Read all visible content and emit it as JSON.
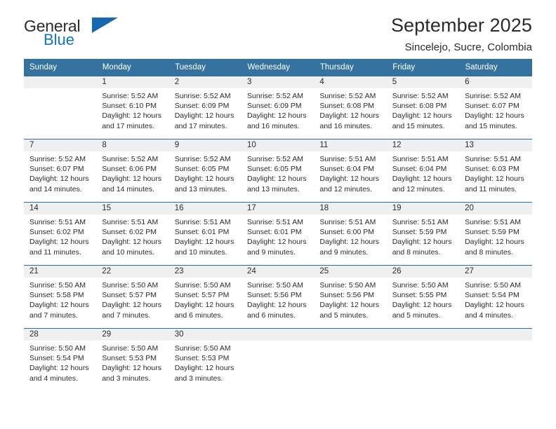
{
  "brand": {
    "name_part1": "General",
    "name_part2": "Blue",
    "triangle_color": "#1668b0",
    "blue_text_color": "#1277bc"
  },
  "header": {
    "title": "September 2025",
    "subtitle": "Sincelejo, Sucre, Colombia"
  },
  "theme": {
    "header_row_bg": "#34739f",
    "day_band_bg": "#f0f0f0",
    "row_border": "#2d6ca2"
  },
  "calendar": {
    "weekday_headers": [
      "Sunday",
      "Monday",
      "Tuesday",
      "Wednesday",
      "Thursday",
      "Friday",
      "Saturday"
    ],
    "weeks": [
      [
        {
          "day": "",
          "sunrise": "",
          "sunset": "",
          "daylight_line1": "",
          "daylight_line2": "",
          "empty": true
        },
        {
          "day": "1",
          "sunrise": "Sunrise: 5:52 AM",
          "sunset": "Sunset: 6:10 PM",
          "daylight_line1": "Daylight: 12 hours",
          "daylight_line2": "and 17 minutes."
        },
        {
          "day": "2",
          "sunrise": "Sunrise: 5:52 AM",
          "sunset": "Sunset: 6:09 PM",
          "daylight_line1": "Daylight: 12 hours",
          "daylight_line2": "and 17 minutes."
        },
        {
          "day": "3",
          "sunrise": "Sunrise: 5:52 AM",
          "sunset": "Sunset: 6:09 PM",
          "daylight_line1": "Daylight: 12 hours",
          "daylight_line2": "and 16 minutes."
        },
        {
          "day": "4",
          "sunrise": "Sunrise: 5:52 AM",
          "sunset": "Sunset: 6:08 PM",
          "daylight_line1": "Daylight: 12 hours",
          "daylight_line2": "and 16 minutes."
        },
        {
          "day": "5",
          "sunrise": "Sunrise: 5:52 AM",
          "sunset": "Sunset: 6:08 PM",
          "daylight_line1": "Daylight: 12 hours",
          "daylight_line2": "and 15 minutes."
        },
        {
          "day": "6",
          "sunrise": "Sunrise: 5:52 AM",
          "sunset": "Sunset: 6:07 PM",
          "daylight_line1": "Daylight: 12 hours",
          "daylight_line2": "and 15 minutes."
        }
      ],
      [
        {
          "day": "7",
          "sunrise": "Sunrise: 5:52 AM",
          "sunset": "Sunset: 6:07 PM",
          "daylight_line1": "Daylight: 12 hours",
          "daylight_line2": "and 14 minutes."
        },
        {
          "day": "8",
          "sunrise": "Sunrise: 5:52 AM",
          "sunset": "Sunset: 6:06 PM",
          "daylight_line1": "Daylight: 12 hours",
          "daylight_line2": "and 14 minutes."
        },
        {
          "day": "9",
          "sunrise": "Sunrise: 5:52 AM",
          "sunset": "Sunset: 6:05 PM",
          "daylight_line1": "Daylight: 12 hours",
          "daylight_line2": "and 13 minutes."
        },
        {
          "day": "10",
          "sunrise": "Sunrise: 5:52 AM",
          "sunset": "Sunset: 6:05 PM",
          "daylight_line1": "Daylight: 12 hours",
          "daylight_line2": "and 13 minutes."
        },
        {
          "day": "11",
          "sunrise": "Sunrise: 5:51 AM",
          "sunset": "Sunset: 6:04 PM",
          "daylight_line1": "Daylight: 12 hours",
          "daylight_line2": "and 12 minutes."
        },
        {
          "day": "12",
          "sunrise": "Sunrise: 5:51 AM",
          "sunset": "Sunset: 6:04 PM",
          "daylight_line1": "Daylight: 12 hours",
          "daylight_line2": "and 12 minutes."
        },
        {
          "day": "13",
          "sunrise": "Sunrise: 5:51 AM",
          "sunset": "Sunset: 6:03 PM",
          "daylight_line1": "Daylight: 12 hours",
          "daylight_line2": "and 11 minutes."
        }
      ],
      [
        {
          "day": "14",
          "sunrise": "Sunrise: 5:51 AM",
          "sunset": "Sunset: 6:02 PM",
          "daylight_line1": "Daylight: 12 hours",
          "daylight_line2": "and 11 minutes."
        },
        {
          "day": "15",
          "sunrise": "Sunrise: 5:51 AM",
          "sunset": "Sunset: 6:02 PM",
          "daylight_line1": "Daylight: 12 hours",
          "daylight_line2": "and 10 minutes."
        },
        {
          "day": "16",
          "sunrise": "Sunrise: 5:51 AM",
          "sunset": "Sunset: 6:01 PM",
          "daylight_line1": "Daylight: 12 hours",
          "daylight_line2": "and 10 minutes."
        },
        {
          "day": "17",
          "sunrise": "Sunrise: 5:51 AM",
          "sunset": "Sunset: 6:01 PM",
          "daylight_line1": "Daylight: 12 hours",
          "daylight_line2": "and 9 minutes."
        },
        {
          "day": "18",
          "sunrise": "Sunrise: 5:51 AM",
          "sunset": "Sunset: 6:00 PM",
          "daylight_line1": "Daylight: 12 hours",
          "daylight_line2": "and 9 minutes."
        },
        {
          "day": "19",
          "sunrise": "Sunrise: 5:51 AM",
          "sunset": "Sunset: 5:59 PM",
          "daylight_line1": "Daylight: 12 hours",
          "daylight_line2": "and 8 minutes."
        },
        {
          "day": "20",
          "sunrise": "Sunrise: 5:51 AM",
          "sunset": "Sunset: 5:59 PM",
          "daylight_line1": "Daylight: 12 hours",
          "daylight_line2": "and 8 minutes."
        }
      ],
      [
        {
          "day": "21",
          "sunrise": "Sunrise: 5:50 AM",
          "sunset": "Sunset: 5:58 PM",
          "daylight_line1": "Daylight: 12 hours",
          "daylight_line2": "and 7 minutes."
        },
        {
          "day": "22",
          "sunrise": "Sunrise: 5:50 AM",
          "sunset": "Sunset: 5:57 PM",
          "daylight_line1": "Daylight: 12 hours",
          "daylight_line2": "and 7 minutes."
        },
        {
          "day": "23",
          "sunrise": "Sunrise: 5:50 AM",
          "sunset": "Sunset: 5:57 PM",
          "daylight_line1": "Daylight: 12 hours",
          "daylight_line2": "and 6 minutes."
        },
        {
          "day": "24",
          "sunrise": "Sunrise: 5:50 AM",
          "sunset": "Sunset: 5:56 PM",
          "daylight_line1": "Daylight: 12 hours",
          "daylight_line2": "and 6 minutes."
        },
        {
          "day": "25",
          "sunrise": "Sunrise: 5:50 AM",
          "sunset": "Sunset: 5:56 PM",
          "daylight_line1": "Daylight: 12 hours",
          "daylight_line2": "and 5 minutes."
        },
        {
          "day": "26",
          "sunrise": "Sunrise: 5:50 AM",
          "sunset": "Sunset: 5:55 PM",
          "daylight_line1": "Daylight: 12 hours",
          "daylight_line2": "and 5 minutes."
        },
        {
          "day": "27",
          "sunrise": "Sunrise: 5:50 AM",
          "sunset": "Sunset: 5:54 PM",
          "daylight_line1": "Daylight: 12 hours",
          "daylight_line2": "and 4 minutes."
        }
      ],
      [
        {
          "day": "28",
          "sunrise": "Sunrise: 5:50 AM",
          "sunset": "Sunset: 5:54 PM",
          "daylight_line1": "Daylight: 12 hours",
          "daylight_line2": "and 4 minutes."
        },
        {
          "day": "29",
          "sunrise": "Sunrise: 5:50 AM",
          "sunset": "Sunset: 5:53 PM",
          "daylight_line1": "Daylight: 12 hours",
          "daylight_line2": "and 3 minutes."
        },
        {
          "day": "30",
          "sunrise": "Sunrise: 5:50 AM",
          "sunset": "Sunset: 5:53 PM",
          "daylight_line1": "Daylight: 12 hours",
          "daylight_line2": "and 3 minutes."
        },
        {
          "day": "",
          "sunrise": "",
          "sunset": "",
          "daylight_line1": "",
          "daylight_line2": "",
          "empty": true
        },
        {
          "day": "",
          "sunrise": "",
          "sunset": "",
          "daylight_line1": "",
          "daylight_line2": "",
          "empty": true
        },
        {
          "day": "",
          "sunrise": "",
          "sunset": "",
          "daylight_line1": "",
          "daylight_line2": "",
          "empty": true
        },
        {
          "day": "",
          "sunrise": "",
          "sunset": "",
          "daylight_line1": "",
          "daylight_line2": "",
          "empty": true
        }
      ]
    ]
  }
}
